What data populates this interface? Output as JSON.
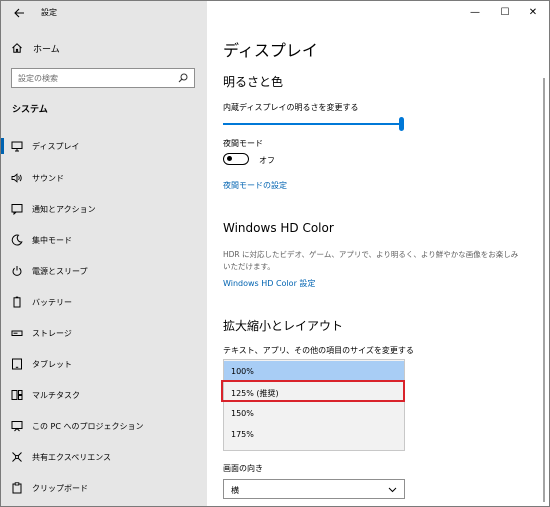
{
  "window": {
    "title": "設定",
    "controls": {
      "minimize": "—",
      "maximize": "☐",
      "close": "✕"
    }
  },
  "sidebar": {
    "home_label": "ホーム",
    "search_placeholder": "設定の検索",
    "section_label": "システム",
    "items": [
      {
        "label": "ディスプレイ",
        "icon": "monitor-icon",
        "active": true
      },
      {
        "label": "サウンド",
        "icon": "speaker-icon",
        "active": false
      },
      {
        "label": "通知とアクション",
        "icon": "notification-icon",
        "active": false
      },
      {
        "label": "集中モード",
        "icon": "moon-icon",
        "active": false
      },
      {
        "label": "電源とスリープ",
        "icon": "power-icon",
        "active": false
      },
      {
        "label": "バッテリー",
        "icon": "battery-icon",
        "active": false
      },
      {
        "label": "ストレージ",
        "icon": "storage-icon",
        "active": false
      },
      {
        "label": "タブレット",
        "icon": "tablet-icon",
        "active": false
      },
      {
        "label": "マルチタスク",
        "icon": "multitask-icon",
        "active": false
      },
      {
        "label": "この PC へのプロジェクション",
        "icon": "projection-icon",
        "active": false
      },
      {
        "label": "共有エクスペリエンス",
        "icon": "share-icon",
        "active": false
      },
      {
        "label": "クリップボード",
        "icon": "clipboard-icon",
        "active": false
      }
    ]
  },
  "content": {
    "page_title": "ディスプレイ",
    "brightness": {
      "heading": "明るさと色",
      "slider_label": "内蔵ディスプレイの明るさを変更する",
      "slider_value_percent": 100
    },
    "night_mode": {
      "label": "夜間モード",
      "state": "オフ",
      "settings_link": "夜間モードの設定"
    },
    "hd_color": {
      "heading": "Windows HD Color",
      "description": "HDR に対応したビデオ、ゲーム、アプリで、より明るく、より鮮やかな画像をお楽しみいただけます。",
      "settings_link": "Windows HD Color 設定"
    },
    "scale_layout": {
      "heading": "拡大縮小とレイアウト",
      "scale_label": "テキスト、アプリ、その他の項目のサイズを変更する",
      "options": [
        "100%",
        "125% (推奨)",
        "150%",
        "175%"
      ],
      "selected_option": "100%",
      "highlighted_option": "125% (推奨)"
    },
    "orientation": {
      "label": "画面の向き",
      "value": "横"
    }
  },
  "colors": {
    "accent": "#0078d7",
    "link": "#0063b1",
    "highlight_border": "#d9232b",
    "sidebar_bg": "#e6e6e6",
    "selected_option_bg": "#a8cdf5"
  }
}
